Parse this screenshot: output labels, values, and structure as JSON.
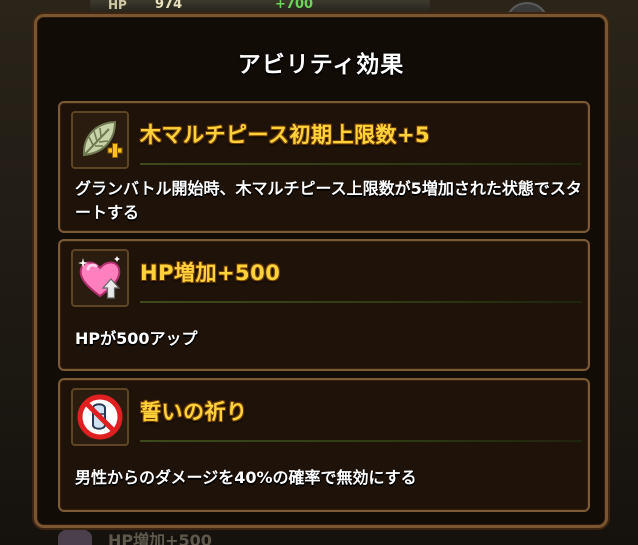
{
  "background": {
    "hp_tag": "HP",
    "hp_value": "974",
    "hp_bonus": "+700",
    "bottom_peek_text": "HP増加+500"
  },
  "dialog": {
    "title": "アビリティ効果"
  },
  "abilities": [
    {
      "icon": "leaf-plus-icon",
      "title": "木マルチピース初期上限数+5",
      "description": "グランバトル開始時、木マルチピース上限数が5増加された状態でスタートする"
    },
    {
      "icon": "heart-up-icon",
      "title": "HP増加+500",
      "description": "HPが500アップ"
    },
    {
      "icon": "no-sock-icon",
      "title": "誓いの祈り",
      "description": "男性からのダメージを40%の確率で無効にする"
    }
  ],
  "colors": {
    "title_yellow": "#ffd23a",
    "frame_brown": "#7a5530",
    "panel_dark": "#1f1309"
  }
}
